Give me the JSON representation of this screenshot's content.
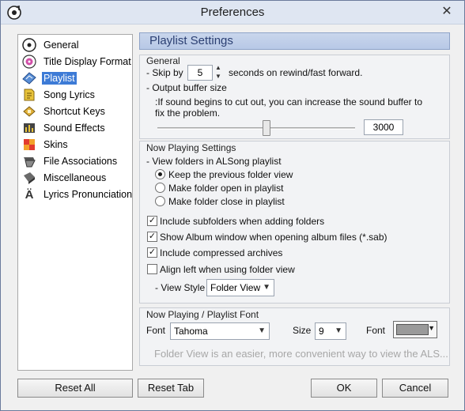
{
  "window": {
    "title": "Preferences",
    "close_glyph": "✕"
  },
  "sidebar": {
    "items": [
      {
        "label": "General",
        "icon": "disc-icon",
        "selected": false
      },
      {
        "label": "Title Display Format",
        "icon": "pink-disc-icon",
        "selected": false
      },
      {
        "label": "Playlist",
        "icon": "playlist-icon",
        "selected": true
      },
      {
        "label": "Song Lyrics",
        "icon": "note-icon",
        "selected": false
      },
      {
        "label": "Shortcut Keys",
        "icon": "keyboard-icon",
        "selected": false
      },
      {
        "label": "Sound Effects",
        "icon": "equalizer-icon",
        "selected": false
      },
      {
        "label": "Skins",
        "icon": "skins-icon",
        "selected": false
      },
      {
        "label": "File Associations",
        "icon": "file-assoc-icon",
        "selected": false
      },
      {
        "label": "Miscellaneous",
        "icon": "misc-icon",
        "selected": false
      },
      {
        "label": "Lyrics Pronunciation",
        "icon": "lyrics-pronunciation-icon",
        "selected": false
      }
    ]
  },
  "content": {
    "header": "Playlist Settings",
    "general": {
      "title": "General",
      "skip_prefix": "- Skip by",
      "skip_value": "5",
      "skip_suffix": "seconds on rewind/fast forward.",
      "buffer_label": "- Output buffer size",
      "buffer_hint_line1": ":If sound begins to cut out, you can increase the sound buffer to",
      "buffer_hint_line2": "fix the problem.",
      "buffer_value": "3000",
      "buffer_slider_level": 0.55
    },
    "now_playing": {
      "title": "Now Playing Settings",
      "view_folders_label": "- View folders in ALSong playlist",
      "radios": [
        {
          "label": "Keep the previous folder view",
          "checked": true
        },
        {
          "label": "Make folder open in playlist",
          "checked": false
        },
        {
          "label": "Make folder close in playlist",
          "checked": false
        }
      ],
      "checks": [
        {
          "label": "Include subfolders when adding folders",
          "checked": true
        },
        {
          "label": "Show Album window when opening album files (*.sab)",
          "checked": true
        },
        {
          "label": "Include compressed archives",
          "checked": true
        },
        {
          "label": "Align left when using folder view",
          "checked": false
        }
      ],
      "view_style_label": "- View Style",
      "view_style_value": "Folder View"
    },
    "font": {
      "title": "Now Playing / Playlist Font",
      "font_label": "Font",
      "font_value": "Tahoma",
      "size_label": "Size",
      "size_value": "9",
      "color_label": "Font",
      "color_value": "#9a9a9a",
      "preview_text": "Folder View is an easier, more convenient way to view the ALS..."
    }
  },
  "buttons": {
    "reset_all": "Reset All",
    "reset_tab": "Reset Tab",
    "ok": "OK",
    "cancel": "Cancel"
  },
  "glyphs": {
    "check": "✓",
    "dropdown": "▼",
    "spin_up": "▲",
    "spin_down": "▼"
  }
}
